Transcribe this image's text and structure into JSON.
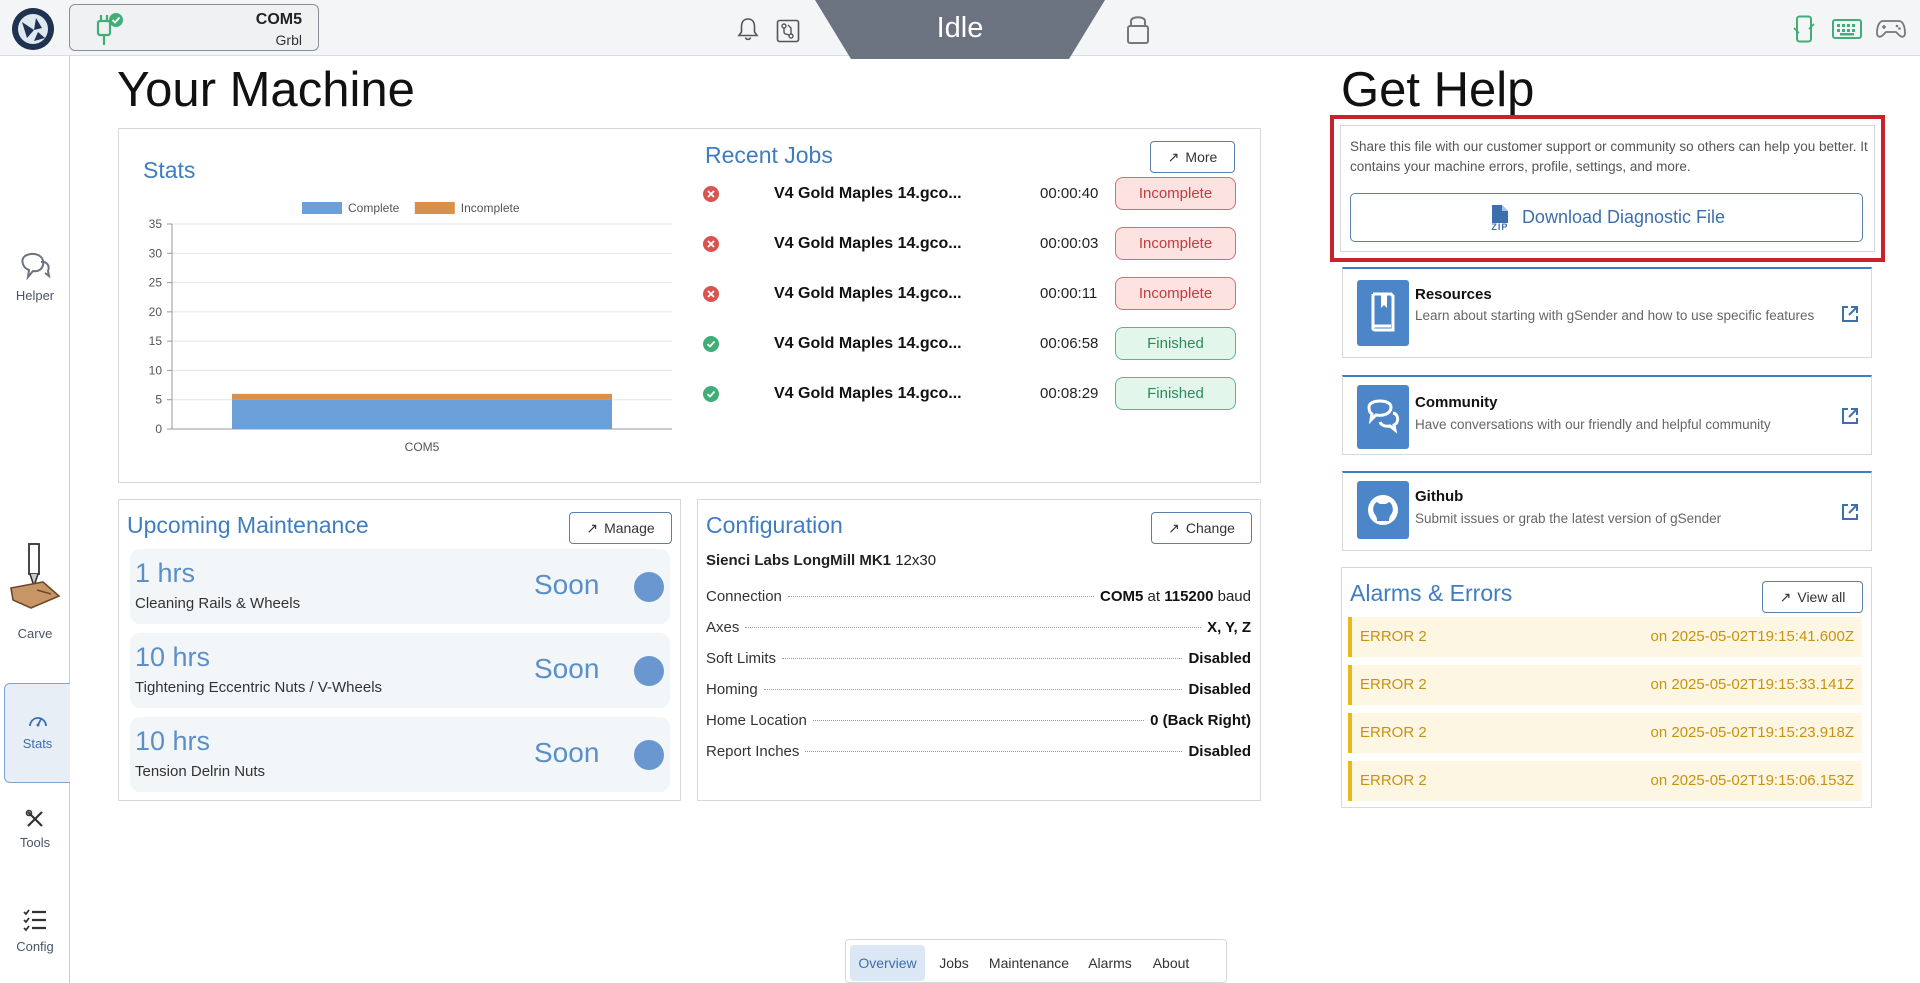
{
  "topbar": {
    "port": "COM5",
    "firmware": "Grbl",
    "state": "Idle"
  },
  "sidebar": {
    "items": [
      {
        "label": "Helper"
      },
      {
        "label": "Carve"
      },
      {
        "label": "Stats"
      },
      {
        "label": "Tools"
      },
      {
        "label": "Config"
      }
    ]
  },
  "machine": {
    "title": "Your Machine",
    "stats_title": "Stats",
    "recent_jobs_title": "Recent Jobs",
    "more_label": "More",
    "jobs": [
      {
        "name": "V4 Gold Maples 14.gco...",
        "duration": "00:00:40",
        "status": "Incomplete"
      },
      {
        "name": "V4 Gold Maples 14.gco...",
        "duration": "00:00:03",
        "status": "Incomplete"
      },
      {
        "name": "V4 Gold Maples 14.gco...",
        "duration": "00:00:11",
        "status": "Incomplete"
      },
      {
        "name": "V4 Gold Maples 14.gco...",
        "duration": "00:06:58",
        "status": "Finished"
      },
      {
        "name": "V4 Gold Maples 14.gco...",
        "duration": "00:08:29",
        "status": "Finished"
      }
    ]
  },
  "chart_data": {
    "type": "bar",
    "stacked": true,
    "categories": [
      "COM5"
    ],
    "series": [
      {
        "name": "Complete",
        "values": [
          5
        ],
        "color": "#6a9fd8"
      },
      {
        "name": "Incomplete",
        "values": [
          1
        ],
        "color": "#d9904a"
      }
    ],
    "yticks": [
      "0",
      "5",
      "10",
      "15",
      "20",
      "25",
      "30",
      "35"
    ],
    "ylim": [
      0,
      35
    ],
    "legend": "top"
  },
  "maintenance": {
    "title": "Upcoming Maintenance",
    "manage_label": "Manage",
    "items": [
      {
        "hours": "1 hrs",
        "task": "Cleaning Rails & Wheels",
        "status": "Soon"
      },
      {
        "hours": "10 hrs",
        "task": "Tightening Eccentric Nuts / V-Wheels",
        "status": "Soon"
      },
      {
        "hours": "10 hrs",
        "task": "Tension Delrin Nuts",
        "status": "Soon"
      }
    ]
  },
  "configuration": {
    "title": "Configuration",
    "change_label": "Change",
    "machine_name": "Sienci Labs LongMill MK1",
    "machine_size": "12x30",
    "connection": {
      "label": "Connection",
      "port": "COM5",
      "at": "at",
      "baud": "115200",
      "unit": "baud"
    },
    "rows": [
      {
        "label": "Axes",
        "value": "X, Y, Z"
      },
      {
        "label": "Soft Limits",
        "value": "Disabled"
      },
      {
        "label": "Homing",
        "value": "Disabled"
      },
      {
        "label": "Home Location",
        "value": "0 (Back Right)"
      },
      {
        "label": "Report Inches",
        "value": "Disabled"
      }
    ]
  },
  "help": {
    "title": "Get Help",
    "share_text": "Share this file with our customer support or community so others can help you better. It contains your machine errors, profile, settings, and more.",
    "zip_label": "ZIP",
    "download_label": "Download Diagnostic File",
    "cards": [
      {
        "title": "Resources",
        "desc": "Learn about starting with gSender and how to use specific features"
      },
      {
        "title": "Community",
        "desc": "Have conversations with our friendly and helpful community"
      },
      {
        "title": "Github",
        "desc": "Submit issues or grab the latest version of gSender"
      }
    ]
  },
  "alarms": {
    "title": "Alarms & Errors",
    "view_all_label": "View all",
    "items": [
      {
        "code": "ERROR 2",
        "when": "on 2025-05-02T19:15:41.600Z"
      },
      {
        "code": "ERROR 2",
        "when": "on 2025-05-02T19:15:33.141Z"
      },
      {
        "code": "ERROR 2",
        "when": "on 2025-05-02T19:15:23.918Z"
      },
      {
        "code": "ERROR 2",
        "when": "on 2025-05-02T19:15:06.153Z"
      }
    ]
  },
  "tabs": [
    {
      "label": "Overview",
      "active": true
    },
    {
      "label": "Jobs"
    },
    {
      "label": "Maintenance"
    },
    {
      "label": "Alarms"
    },
    {
      "label": "About"
    }
  ],
  "colors": {
    "accent": "#3f7dc0",
    "state_bg": "#6b7280",
    "error": "#d9534f",
    "success": "#3fae77",
    "highlight": "#c8232c",
    "warning": "#e9b81f"
  }
}
